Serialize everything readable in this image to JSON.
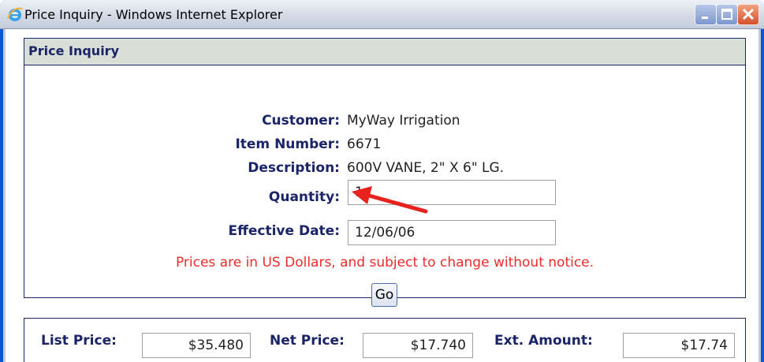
{
  "window": {
    "title": "Price Inquiry - Windows Internet Explorer",
    "icon": "ie-icon",
    "controls": [
      "minimize-icon",
      "maximize-icon",
      "close-icon"
    ]
  },
  "panel": {
    "header": "Price Inquiry",
    "customer": {
      "label": "Customer:",
      "value": "MyWay Irrigation"
    },
    "item_number": {
      "label": "Item Number:",
      "value": "6671"
    },
    "description": {
      "label": "Description:",
      "value": "600V VANE, 2\" X 6\" LG."
    },
    "quantity": {
      "label": "Quantity:",
      "value": "1"
    },
    "effective_date": {
      "label": "Effective Date:",
      "value": "12/06/06"
    },
    "notice": "Prices are in US Dollars, and subject to change without notice.",
    "go_label": "Go"
  },
  "pricing": {
    "list_price": {
      "label": "List Price:",
      "value": "$35.480"
    },
    "net_price": {
      "label": "Net Price:",
      "value": "$17.740"
    },
    "ext_amount": {
      "label": "Ext. Amount:",
      "value": "$17.74"
    }
  },
  "colors": {
    "label": "#1b2468",
    "notice": "#ee2a2a",
    "header_bg": "#d9dfd6",
    "annotation_arrow": "#e8231e"
  }
}
